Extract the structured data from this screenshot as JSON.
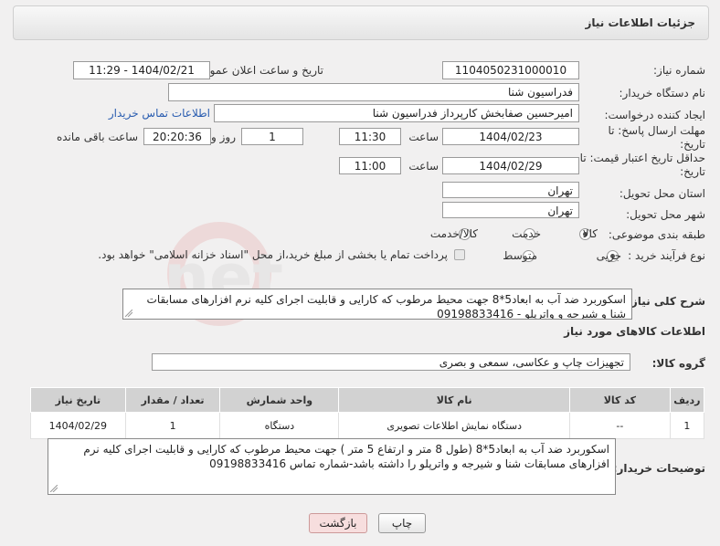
{
  "header": {
    "title": "جزئیات اطلاعات نیاز"
  },
  "fields": {
    "need_number_label": "شماره نیاز:",
    "need_number": "1104050231000010",
    "announce_label": "تاریخ و ساعت اعلان عمومی:",
    "announce_value": "1404/02/21 - 11:29",
    "buyer_org_label": "نام دستگاه خریدار:",
    "buyer_org": "فدراسیون شنا",
    "requester_label": "ایجاد کننده درخواست:",
    "requester": "امیرحسین صفابخش کارپرداز فدراسیون شنا",
    "buyer_contact_link": "اطلاعات تماس خریدار",
    "reply_deadline_label": "مهلت ارسال پاسخ: تا تاریخ:",
    "reply_date": "1404/02/23",
    "hour_label": "ساعت",
    "reply_time": "11:30",
    "days_value": "1",
    "days_label": "روز و",
    "remaining_time": "20:20:36",
    "remaining_label": "ساعت باقی مانده",
    "price_deadline_label": "حداقل تاریخ اعتبار قیمت: تا تاریخ:",
    "price_date": "1404/02/29",
    "price_hour_label": "ساعت",
    "price_time": "11:00",
    "province_label": "استان محل تحویل:",
    "province": "تهران",
    "city_label": "شهر محل تحویل:",
    "city": "تهران",
    "category_label": "طبقه بندی موضوعی:",
    "category_options": [
      "کالا",
      "خدمت",
      "کالا/خدمت"
    ],
    "process_label": "نوع فرآیند خرید :",
    "process_options": [
      "جزیی",
      "متوسط"
    ],
    "payment_note": "پرداخت تمام یا بخشی از مبلغ خرید،از محل \"اسناد خزانه اسلامی\" خواهد بود.",
    "general_desc_label": "شرح کلی نیاز:",
    "general_desc": "اسکوربرد ضد آب به ابعاد5*8  جهت محیط مرطوب که کارایی و قابلیت اجرای کلیه نرم افزارهای مسابقات شنا و شیرجه و واترپلو - 09198833416"
  },
  "goods_section": {
    "title": "اطلاعات کالاهای مورد نیاز",
    "group_label": "گروه کالا:",
    "group_value": "تجهیزات چاپ و عکاسی، سمعی و بصری"
  },
  "table": {
    "headers": [
      "ردیف",
      "کد کالا",
      "نام کالا",
      "واحد شمارش",
      "تعداد / مقدار",
      "تاریخ نیاز"
    ],
    "rows": [
      [
        "1",
        "--",
        "دستگاه نمایش اطلاعات تصویری",
        "دستگاه",
        "1",
        "1404/02/29"
      ]
    ]
  },
  "buyer_notes": {
    "label": "توضیحات خریدار:",
    "text": "اسکوربرد ضد آب به ابعاد5*8 (طول 8 متر و ارتفاع 5 متر ) جهت محیط مرطوب که کارایی و قابلیت اجرای کلیه نرم افزارهای مسابقات شنا و شیرجه و واترپلو را داشته باشد-شماره تماس 09198833416"
  },
  "buttons": {
    "print": "چاپ",
    "back": "بازگشت"
  },
  "watermark_text": "AriaTender.net"
}
